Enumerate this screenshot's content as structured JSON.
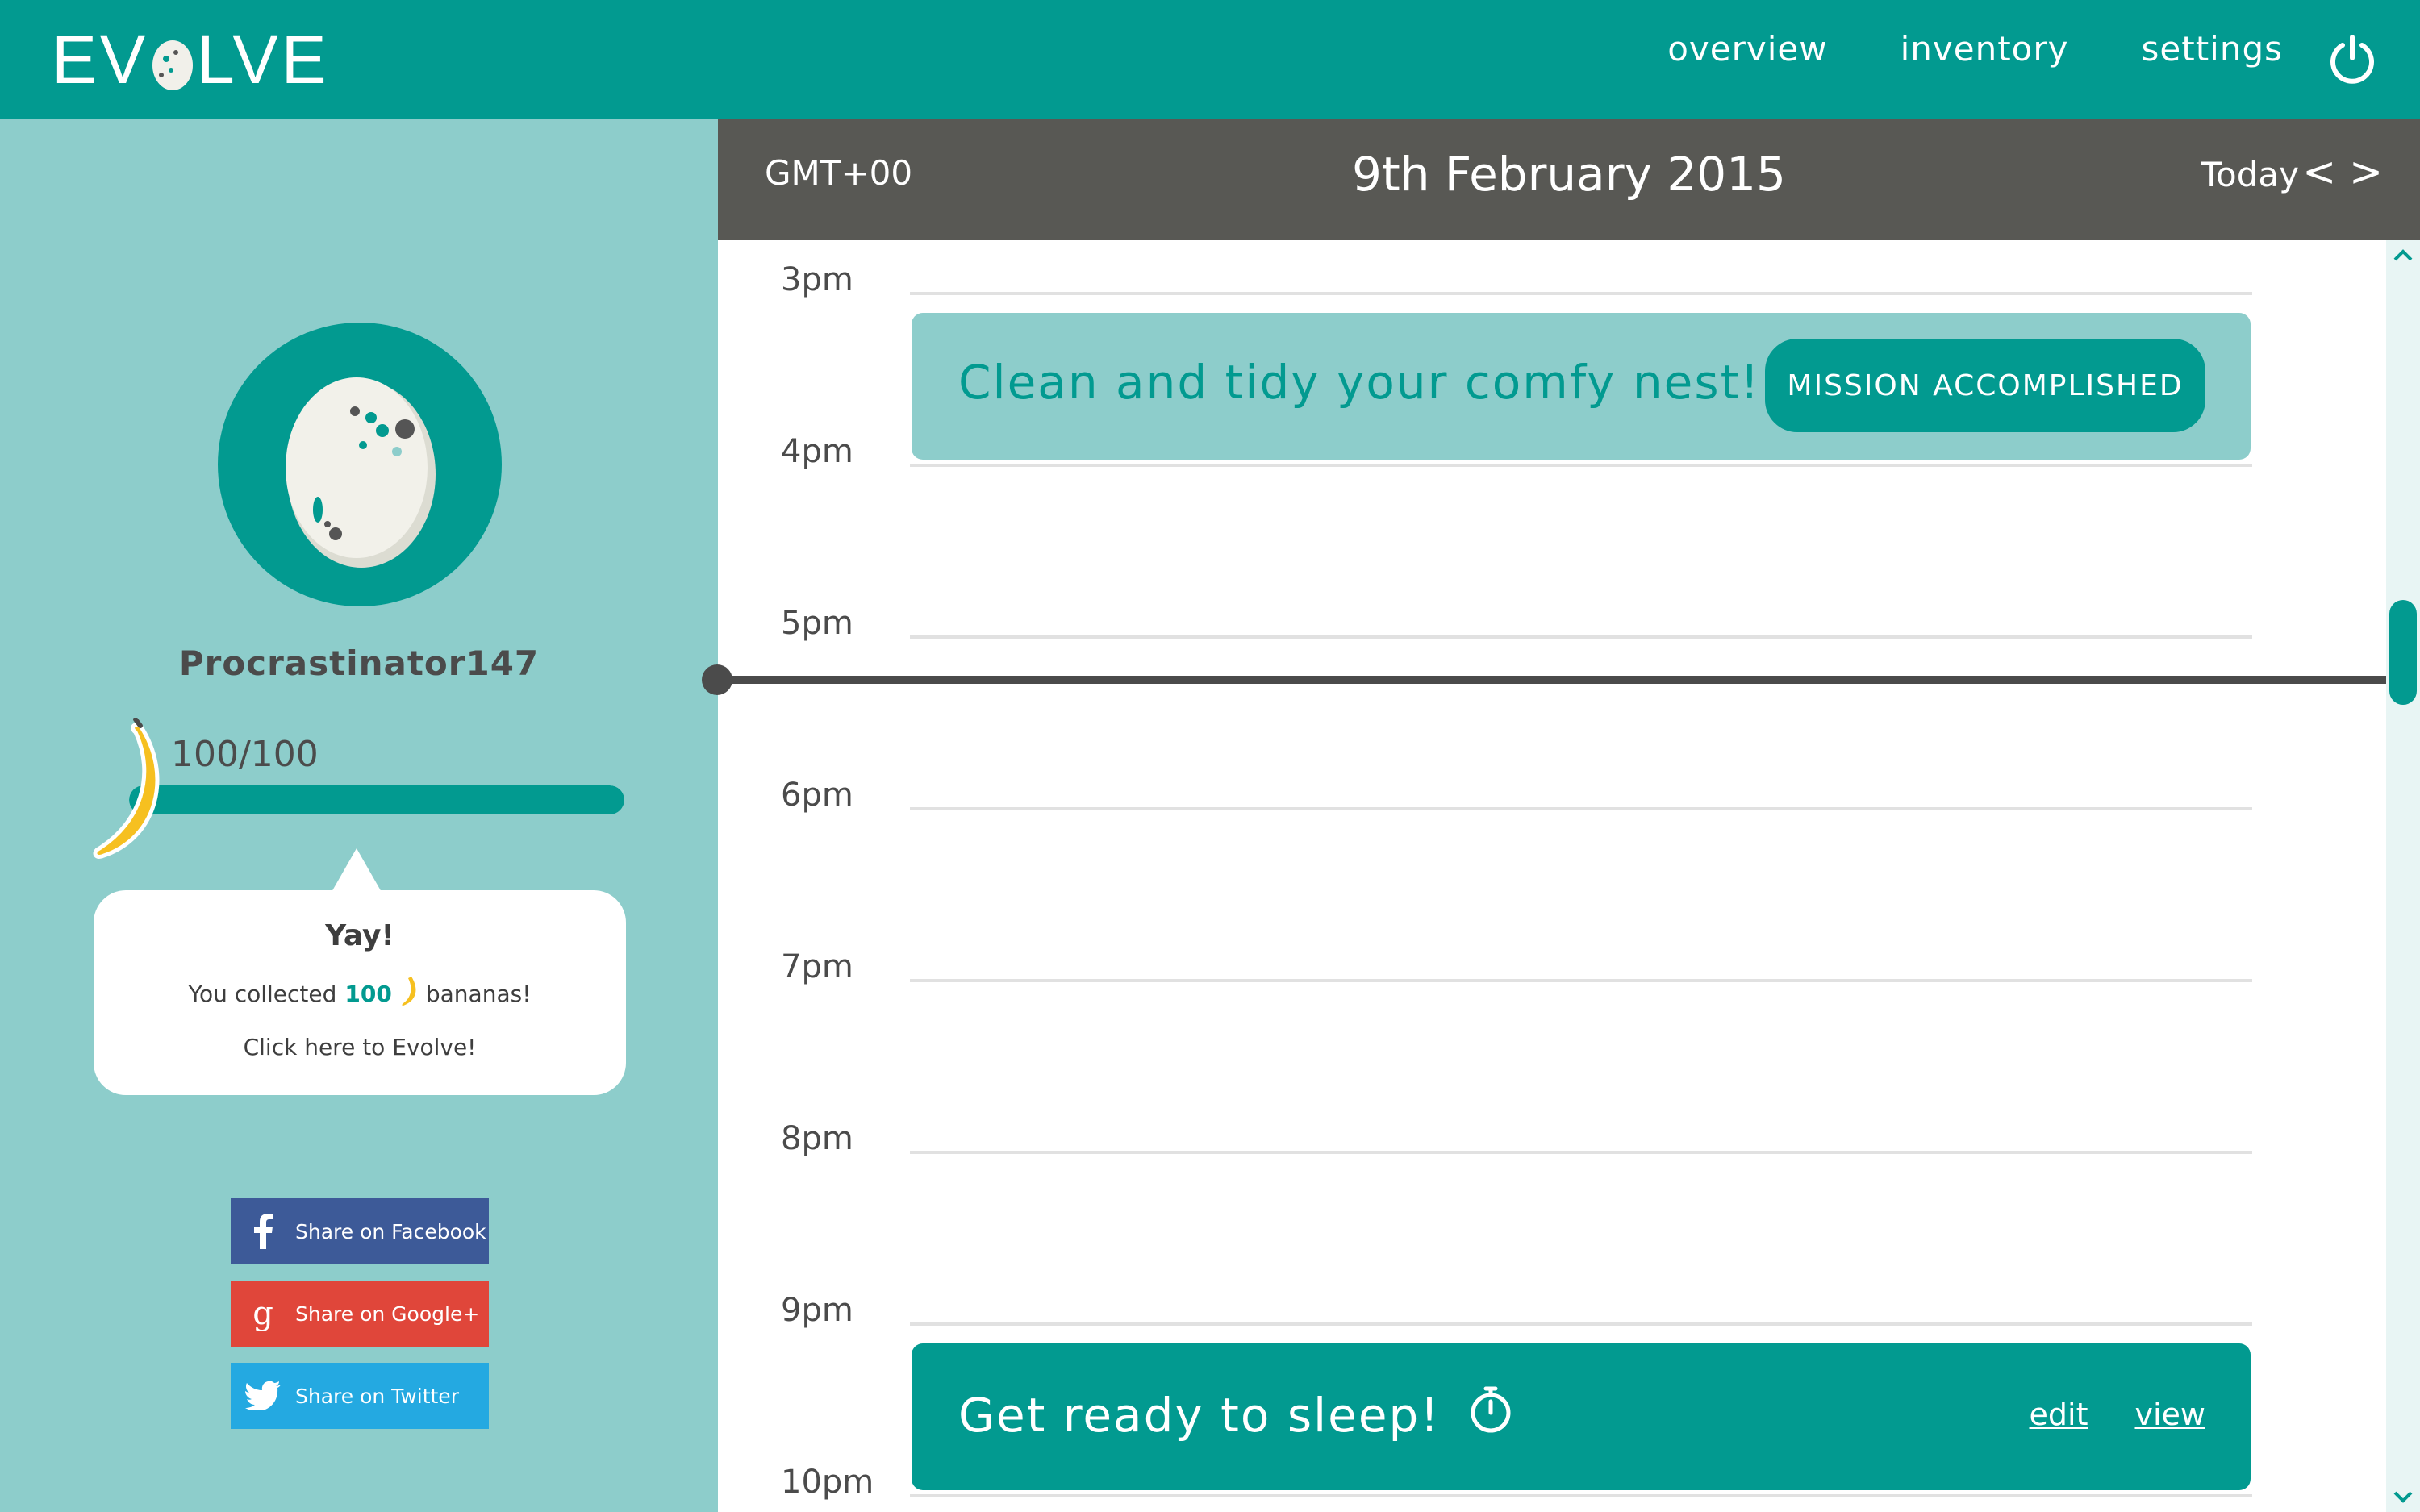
{
  "app": {
    "logo_text_left": "EV",
    "logo_text_right": "LVE"
  },
  "nav": {
    "overview": "overview",
    "inventory": "inventory",
    "settings": "settings",
    "power_icon": "power-icon"
  },
  "profile": {
    "username": "Procrastinator147",
    "bananas_label": "100/100",
    "bananas_current": 100,
    "bananas_max": 100
  },
  "bubble": {
    "title": "Yay!",
    "line_prefix": "You collected",
    "line_count": "100",
    "line_suffix": "bananas!",
    "cta": "Click here to Evolve!"
  },
  "share": {
    "facebook": "Share on Facebook",
    "google": "Share on Google+",
    "twitter": "Share on Twitter"
  },
  "calendar": {
    "timezone": "GMT+00",
    "date": "9th February 2015",
    "today": "Today",
    "prev": "<",
    "next": ">",
    "hours": [
      "3pm",
      "4pm",
      "5pm",
      "6pm",
      "7pm",
      "8pm",
      "9pm",
      "10pm"
    ]
  },
  "events": {
    "nest": {
      "title": "Clean and tidy your comfy nest!",
      "button": "MISSION ACCOMPLISHED"
    },
    "sleep": {
      "title": "Get ready to sleep!",
      "edit": "edit",
      "view": "view"
    }
  },
  "colors": {
    "primary": "#029a90",
    "sidebar": "#8dcdcb",
    "header_dark": "#585854",
    "text_dark": "#4b4b4b",
    "facebook": "#3d5a98",
    "google": "#e0463a",
    "twitter": "#24a9e1"
  }
}
